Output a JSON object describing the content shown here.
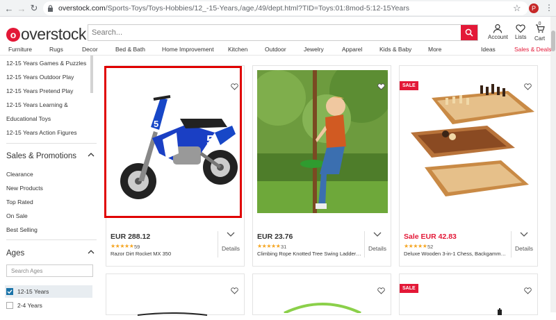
{
  "browser": {
    "url_host": "overstock.com",
    "url_path": "/Sports-Toys/Toys-Hobbies/12_-15-Years,/age,/49/dept.html?TID=Toys:01:8mod-5:12-15Years",
    "profile_initial": "P"
  },
  "header": {
    "logo_text": "overstock",
    "search_placeholder": "Search...",
    "account_label": "Account",
    "lists_label": "Lists",
    "cart_label": "Cart",
    "cart_count": "0",
    "brand_color": "#e31837"
  },
  "categories": [
    "Furniture",
    "Rugs",
    "Decor",
    "Bed & Bath",
    "Home Improvement",
    "Kitchen",
    "Outdoor",
    "Jewelry",
    "Apparel",
    "Kids & Baby",
    "More",
    "Ideas",
    "Sales & Deals"
  ],
  "sidebar": {
    "type_links": [
      "12-15 Years Games & Puzzles",
      "12-15 Years Outdoor Play",
      "12-15 Years Pretend Play",
      "12-15 Years Learning &",
      "Educational Toys",
      "12-15 Years Action Figures"
    ],
    "sales_heading": "Sales & Promotions",
    "sales_links": [
      "Clearance",
      "New Products",
      "Top Rated",
      "On Sale",
      "Best Selling"
    ],
    "ages_heading": "Ages",
    "ages_search_placeholder": "Search Ages",
    "ages": [
      {
        "label": "12-15 Years",
        "checked": true
      },
      {
        "label": "2-4 Years",
        "checked": false
      }
    ]
  },
  "products": [
    {
      "price": "EUR 288.12",
      "rating_count": "59",
      "name": "Razor Dirt Rocket MX 350",
      "details_label": "Details",
      "sale": false,
      "stars": "★★★★★"
    },
    {
      "price": "EUR 23.76",
      "rating_count": "31",
      "name": "Climbing Rope Knotted Tree Swing Ladder- b...",
      "details_label": "Details",
      "sale": false,
      "stars": "★★★★★"
    },
    {
      "price": "Sale EUR 42.83",
      "rating_count": "52",
      "name": "Deluxe Wooden 3-in-1 Chess, Backgammon ...",
      "details_label": "Details",
      "sale": true,
      "sale_badge": "SALE",
      "stars": "★★★★★"
    }
  ],
  "second_row": {
    "sale_badge": "SALE"
  }
}
